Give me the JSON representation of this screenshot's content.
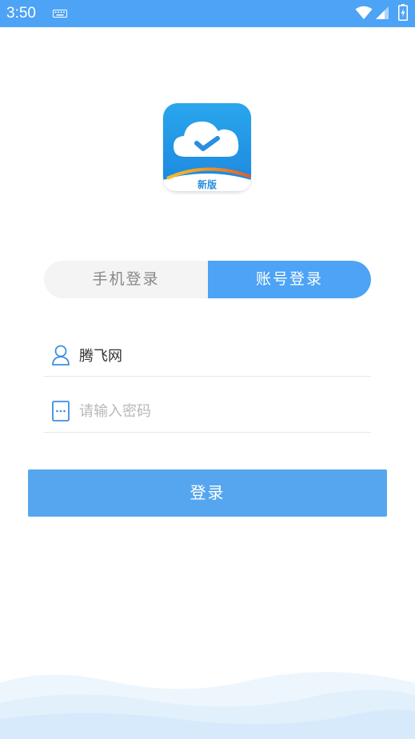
{
  "status_bar": {
    "time": "3:50",
    "icons": [
      "keyboard-icon",
      "wifi-icon",
      "signal-icon",
      "battery-icon"
    ],
    "color": "#4da3f5"
  },
  "logo": {
    "badge_text": "新版",
    "icon": "cloud-check-icon"
  },
  "tabs": [
    {
      "label": "手机登录",
      "active": false
    },
    {
      "label": "账号登录",
      "active": true
    }
  ],
  "form": {
    "username": {
      "value": "腾飞网",
      "icon": "user-icon"
    },
    "password": {
      "value": "",
      "placeholder": "请输入密码",
      "icon": "password-icon"
    }
  },
  "login_button": {
    "label": "登录"
  },
  "colors": {
    "accent": "#4da3f5",
    "button": "#56a6ef",
    "placeholder": "#b8b8b8"
  }
}
